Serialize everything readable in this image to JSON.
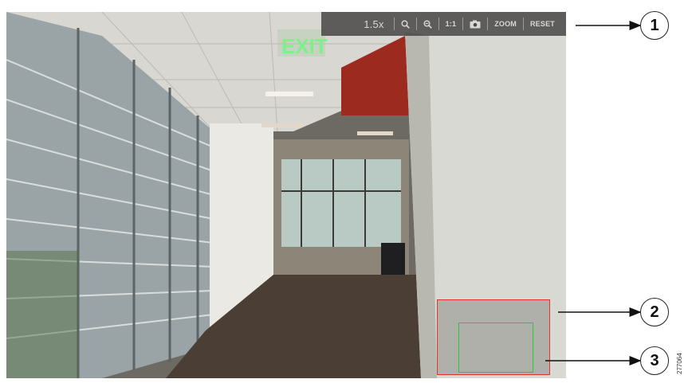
{
  "toolbar": {
    "zoom_level": "1.5x",
    "zoom_in_icon": "zoom-in-icon",
    "zoom_out_icon": "zoom-out-icon",
    "actual_size_label": "1:1",
    "snapshot_icon": "camera-icon",
    "zoom_label": "ZOOM",
    "reset_label": "RESET"
  },
  "scene": {
    "exit_sign": "EXIT"
  },
  "navigator": {
    "outer_color": "#e0312a",
    "inner_color": "#2fc23b"
  },
  "callouts": [
    {
      "number": "1"
    },
    {
      "number": "2"
    },
    {
      "number": "3"
    }
  ],
  "figure_id": "277064"
}
